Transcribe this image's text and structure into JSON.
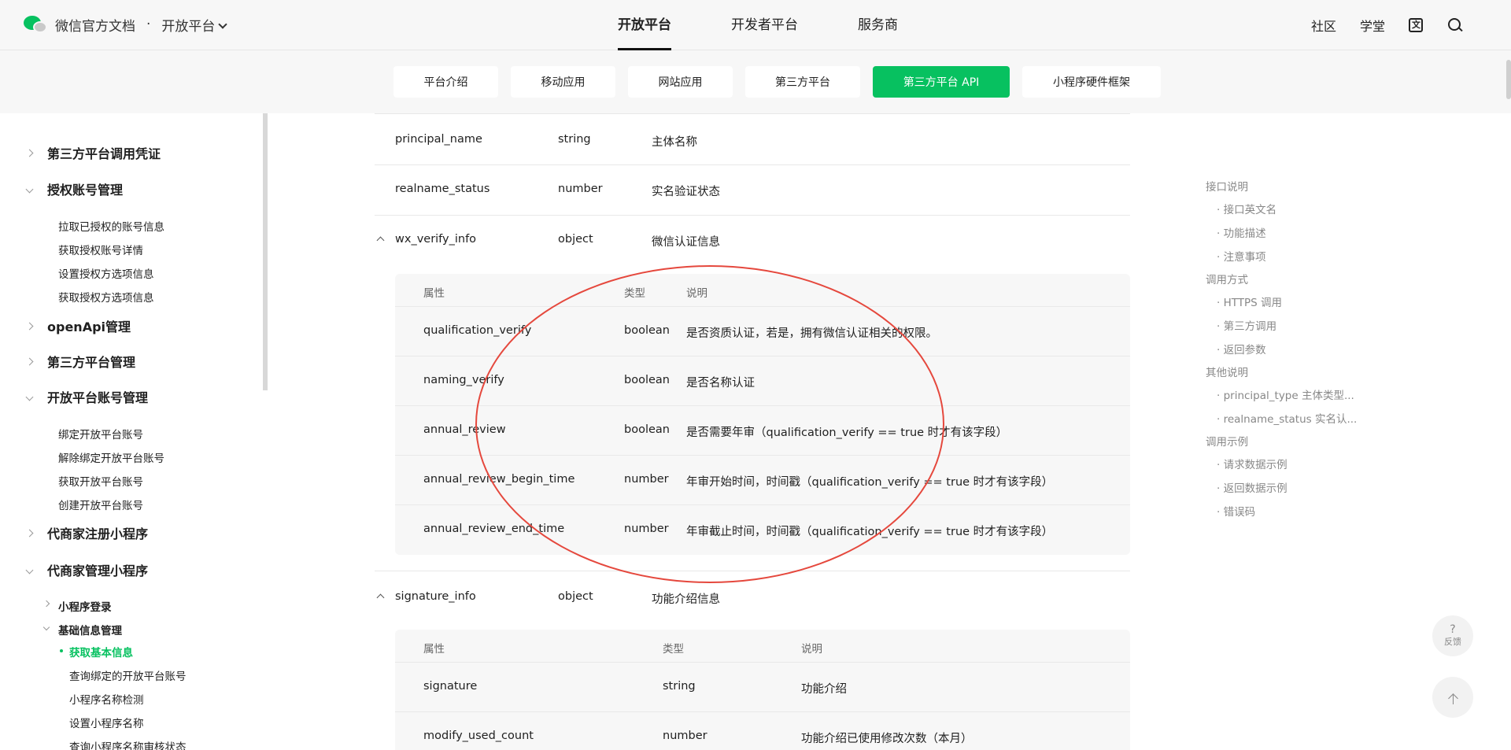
{
  "header": {
    "brand": "微信官方文档",
    "separator": "·",
    "platform_selector": "开放平台",
    "nav": [
      "开放平台",
      "开发者平台",
      "服务商"
    ],
    "right_links": [
      "社区",
      "学堂"
    ]
  },
  "subnav": {
    "tabs": [
      "平台介绍",
      "移动应用",
      "网站应用",
      "第三方平台",
      "第三方平台 API",
      "小程序硬件框架"
    ],
    "active_index": 4
  },
  "sidebar": {
    "groups": [
      {
        "label": "第三方平台调用凭证",
        "expanded": false
      },
      {
        "label": "授权账号管理",
        "expanded": true,
        "items": [
          "拉取已授权的账号信息",
          "获取授权账号详情",
          "设置授权方选项信息",
          "获取授权方选项信息"
        ]
      },
      {
        "label": "openApi管理",
        "expanded": false
      },
      {
        "label": "第三方平台管理",
        "expanded": false
      },
      {
        "label": "开放平台账号管理",
        "expanded": true,
        "items": [
          "绑定开放平台账号",
          "解除绑定开放平台账号",
          "获取开放平台账号",
          "创建开放平台账号"
        ]
      },
      {
        "label": "代商家注册小程序",
        "expanded": false
      },
      {
        "label": "代商家管理小程序",
        "expanded": true
      }
    ],
    "sub_groups": [
      {
        "label": "小程序登录",
        "expanded": false
      },
      {
        "label": "基础信息管理",
        "expanded": true
      }
    ],
    "leaves": [
      "获取基本信息",
      "查询绑定的开放平台账号",
      "小程序名称检测",
      "设置小程序名称",
      "查询小程序名称审核状态"
    ],
    "active_leaf": "获取基本信息"
  },
  "table": {
    "rows": [
      {
        "name": "principal_name",
        "type": "string",
        "desc": "主体名称"
      },
      {
        "name": "realname_status",
        "type": "number",
        "desc": "实名验证状态"
      },
      {
        "name": "wx_verify_info",
        "type": "object",
        "desc": "微信认证信息",
        "expanded": true
      },
      {
        "name": "signature_info",
        "type": "object",
        "desc": "功能介绍信息",
        "expanded": true
      }
    ],
    "nested_headers": [
      "属性",
      "类型",
      "说明"
    ],
    "wx_verify_fields": [
      {
        "name": "qualification_verify",
        "type": "boolean",
        "desc": "是否资质认证，若是，拥有微信认证相关的权限。"
      },
      {
        "name": "naming_verify",
        "type": "boolean",
        "desc": "是否名称认证"
      },
      {
        "name": "annual_review",
        "type": "boolean",
        "desc": "是否需要年审（qualification_verify == true 时才有该字段）"
      },
      {
        "name": "annual_review_begin_time",
        "type": "number",
        "desc": "年审开始时间，时间戳（qualification_verify == true 时才有该字段）"
      },
      {
        "name": "annual_review_end_time",
        "type": "number",
        "desc": "年审截止时间，时间戳（qualification_verify == true 时才有该字段）"
      }
    ],
    "signature_fields": [
      {
        "name": "signature",
        "type": "string",
        "desc": "功能介绍"
      },
      {
        "name": "modify_used_count",
        "type": "number",
        "desc": "功能介绍已使用修改次数（本月）"
      }
    ]
  },
  "toc": {
    "sections": [
      {
        "label": "接口说明",
        "items": [
          "· 接口英文名",
          "· 功能描述",
          "· 注意事项"
        ]
      },
      {
        "label": "调用方式",
        "items": [
          "· HTTPS 调用",
          "· 第三方调用",
          "· 返回参数"
        ]
      },
      {
        "label": "其他说明",
        "items": [
          "· principal_type 主体类型...",
          "· realname_status 实名认..."
        ]
      },
      {
        "label": "调用示例",
        "items": [
          "· 请求数据示例",
          "· 返回数据示例",
          "· 错误码"
        ]
      }
    ]
  },
  "fab": {
    "feedback_symbol": "?",
    "feedback_label": "反馈"
  },
  "colors": {
    "accent": "#07c160",
    "annotation": "#e5483d"
  }
}
